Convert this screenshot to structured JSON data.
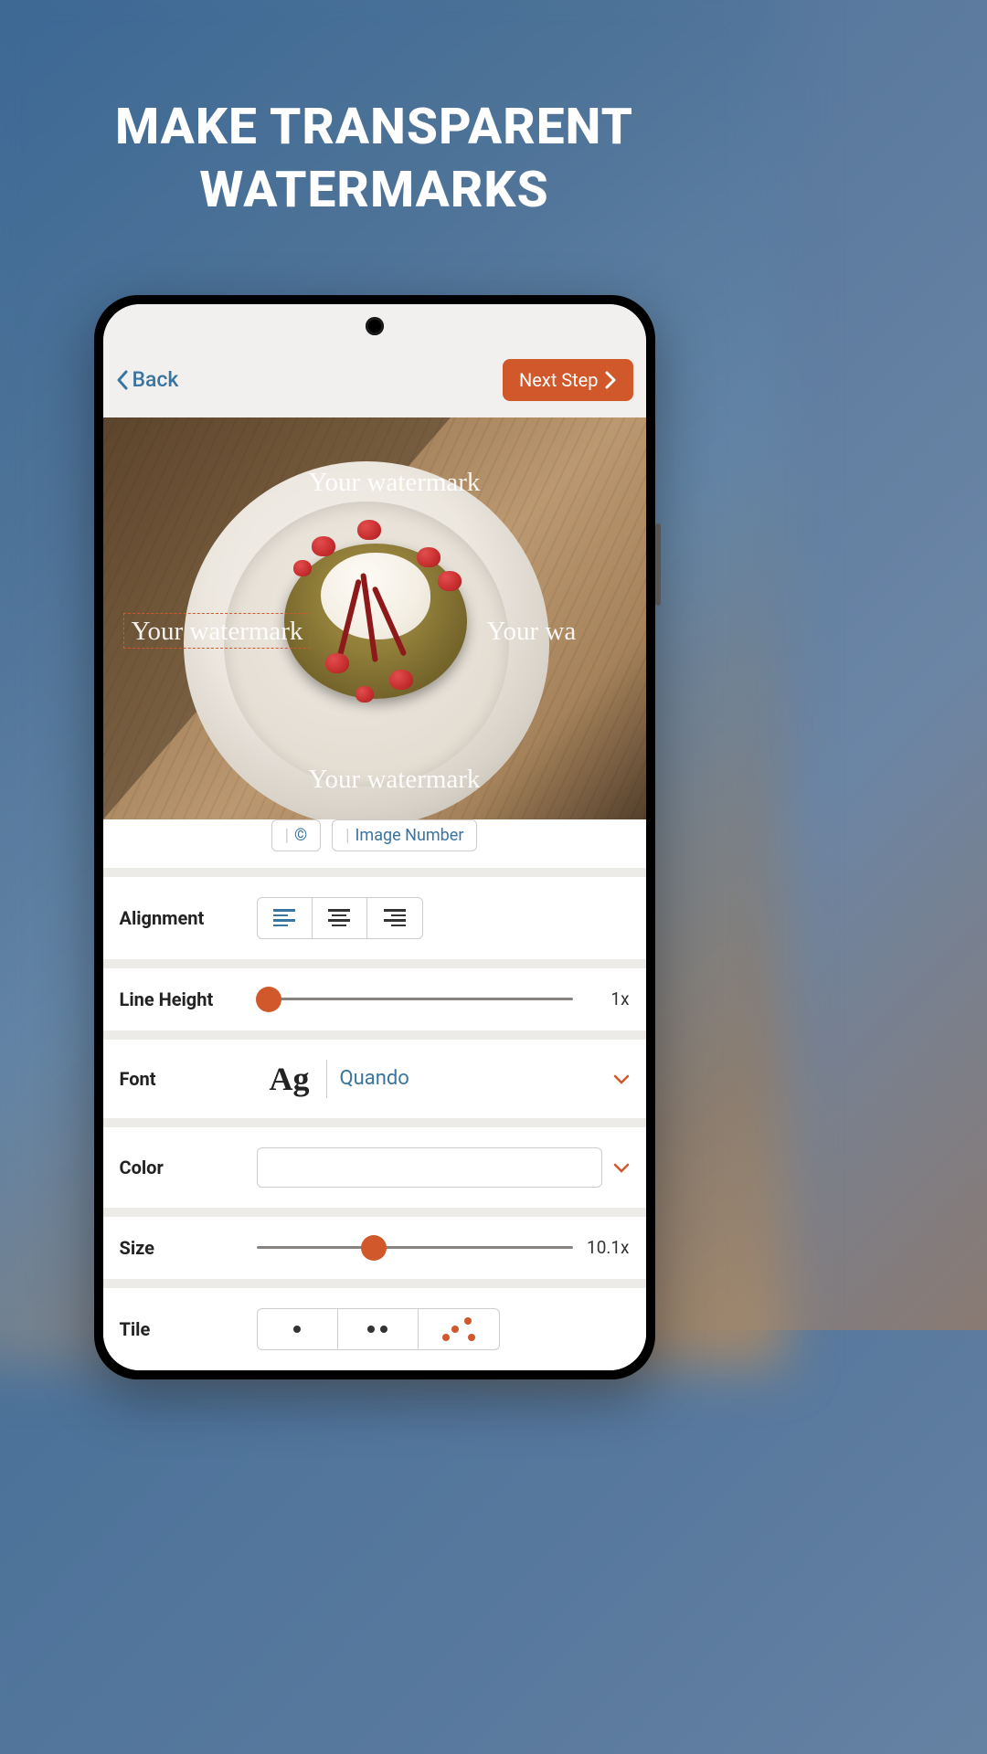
{
  "promo": {
    "title": "MAKE TRANSPARENT WATERMARKS"
  },
  "header": {
    "back": "Back",
    "next": "Next Step"
  },
  "preview": {
    "watermark_text": "Your watermark",
    "watermark_frag": "rmark",
    "watermark_frag2": "Your wa"
  },
  "controls": {
    "image_number_btn": "Image Number",
    "alignment_label": "Alignment",
    "line_height_label": "Line Height",
    "line_height_value": "1x",
    "font_label": "Font",
    "font_preview": "Ag",
    "font_name": "Quando",
    "color_label": "Color",
    "size_label": "Size",
    "size_value": "10.1x",
    "tile_label": "Tile"
  }
}
